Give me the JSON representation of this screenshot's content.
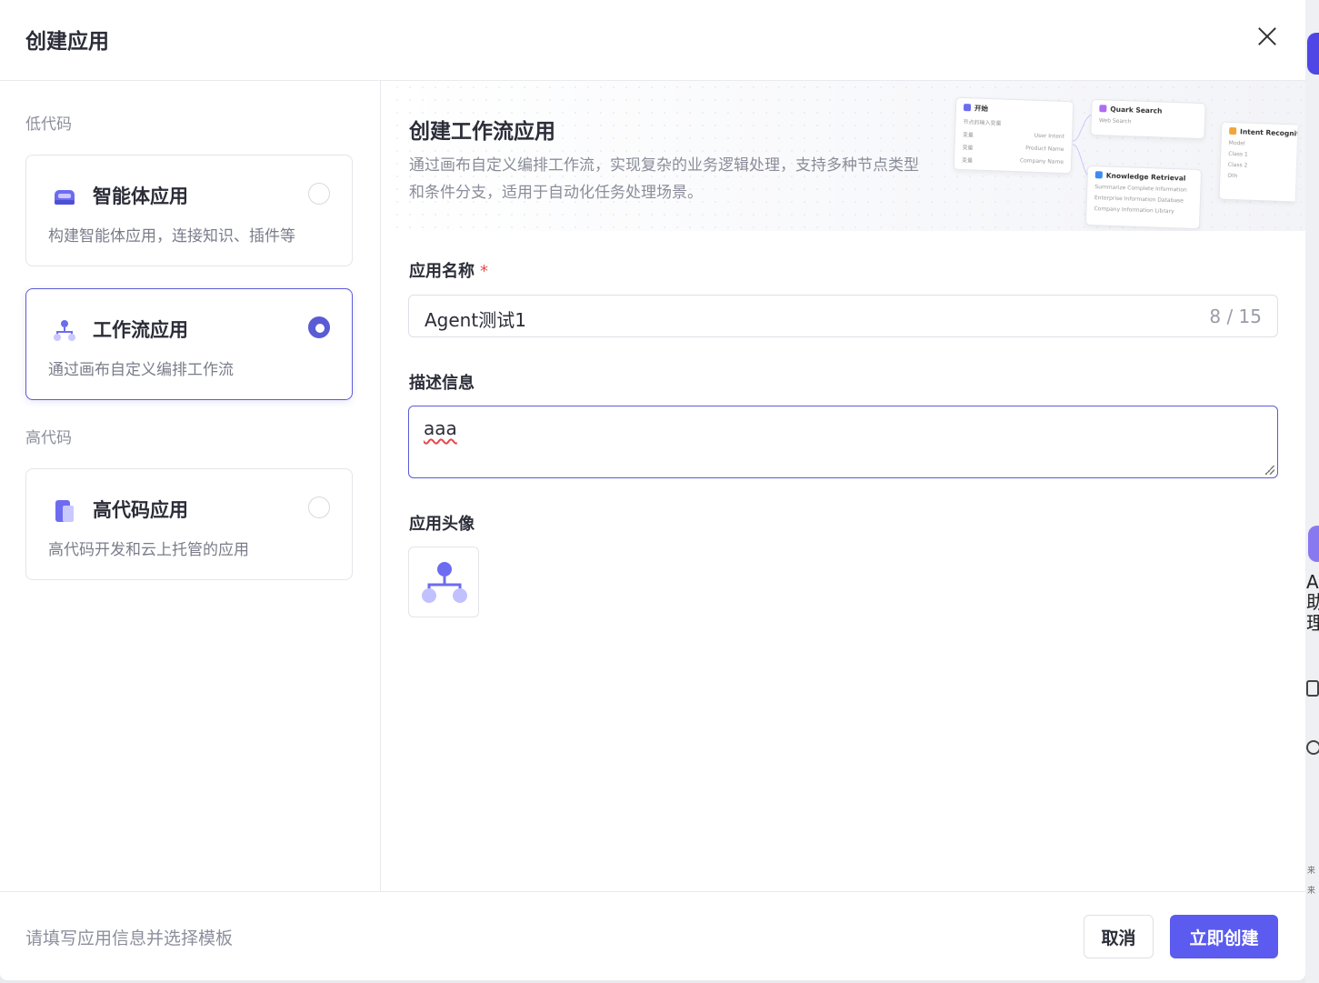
{
  "modal": {
    "title": "创建应用"
  },
  "sidebar": {
    "groups": [
      {
        "label": "低代码"
      },
      {
        "label": "高代码"
      }
    ],
    "cards": [
      {
        "title": "智能体应用",
        "desc": "构建智能体应用，连接知识、插件等",
        "icon": "agent-bot-icon",
        "selected": false
      },
      {
        "title": "工作流应用",
        "desc": "通过画布自定义编排工作流",
        "icon": "workflow-icon",
        "selected": true
      },
      {
        "title": "高代码应用",
        "desc": "高代码开发和云上托管的应用",
        "icon": "document-code-icon",
        "selected": false
      }
    ]
  },
  "banner": {
    "title": "创建工作流应用",
    "desc": "通过画布自定义编排工作流，实现复杂的业务逻辑处理，支持多种节点类型和条件分支，适用于自动化任务处理场景。",
    "preview_nodes": [
      {
        "title": "开始",
        "rows": [
          "节点的输入变量",
          "变量",
          "变量",
          "变量"
        ],
        "side": [
          "User Intent",
          "Product Name",
          "Company Name"
        ]
      },
      {
        "title": "Quark Search",
        "rows": [
          "Web Search"
        ]
      },
      {
        "title": "Knowledge Retrieval",
        "rows": [
          "Summarize Complete Information",
          "Enterprise Information Database",
          "Company Information Library"
        ]
      },
      {
        "title": "Intent Recognit",
        "rows": [
          "Model",
          "Class 1",
          "Class 2",
          "Oth"
        ]
      }
    ]
  },
  "form": {
    "name_label": "应用名称",
    "required_mark": "*",
    "name_value": "Agent测试1",
    "name_count": "8 / 15",
    "desc_label": "描述信息",
    "desc_value": "aaa",
    "avatar_label": "应用头像",
    "avatar_icon": "workflow-icon"
  },
  "footer": {
    "hint": "请填写应用信息并选择模板",
    "cancel_label": "取消",
    "create_label": "立即创建"
  },
  "colors": {
    "accent": "#5b5bf0",
    "selected_border": "#5b5bd6",
    "required": "#e5484d"
  },
  "backdrop": {
    "glyphs": [
      "A",
      "助",
      "理"
    ],
    "small": [
      "来",
      "来"
    ]
  }
}
